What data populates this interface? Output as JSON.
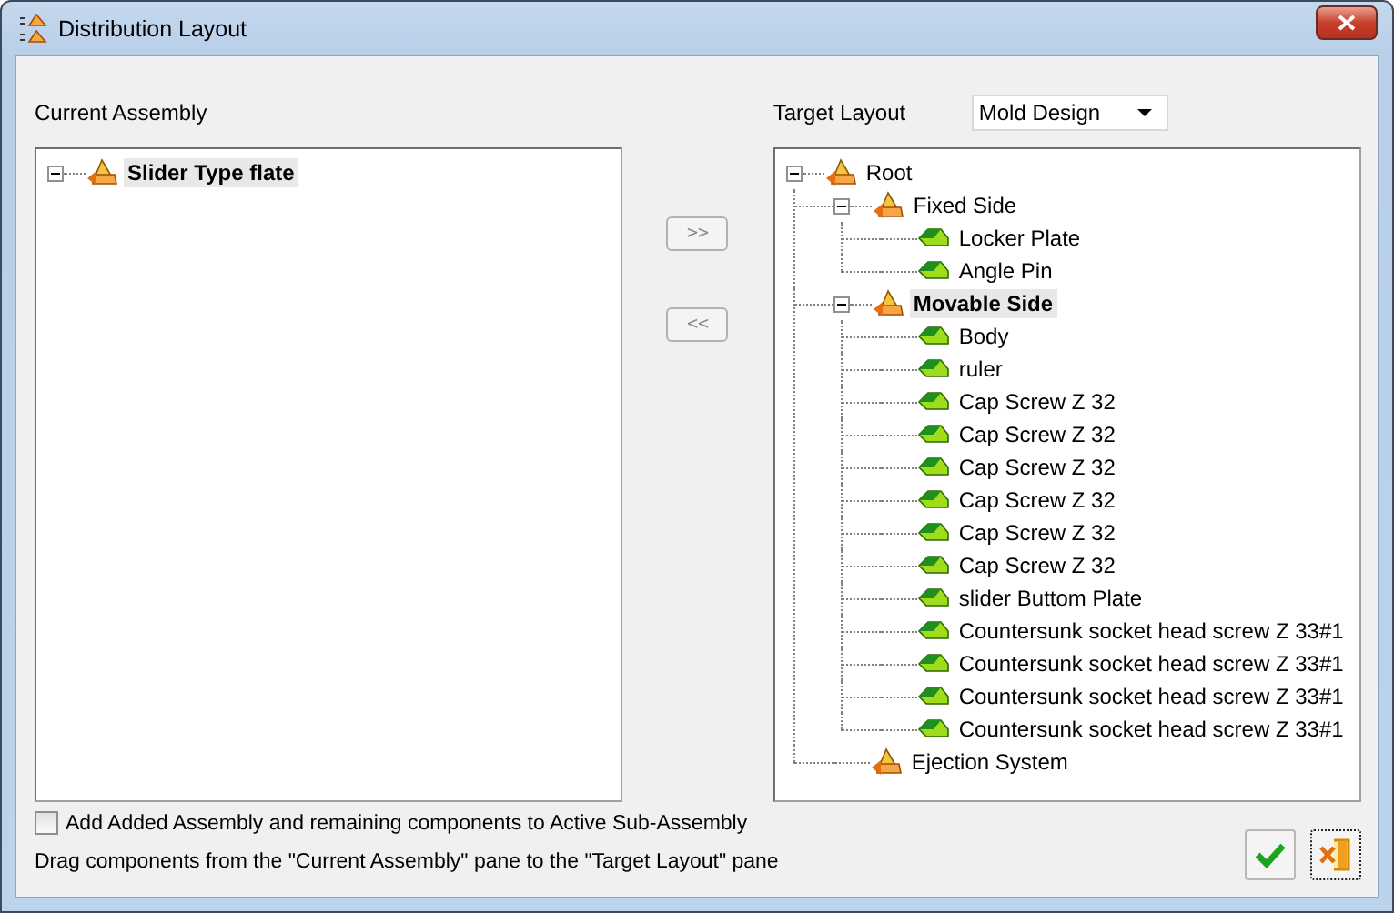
{
  "window": {
    "title": "Distribution Layout"
  },
  "current_assembly": {
    "label": "Current Assembly",
    "tree": [
      {
        "label": "Slider Type flate",
        "kind": "assembly",
        "selected": true,
        "expanded": true
      }
    ]
  },
  "target_layout": {
    "label": "Target Layout",
    "dropdown": {
      "value": "Mold Design"
    },
    "tree": [
      {
        "label": "Root",
        "kind": "assembly",
        "selected": false,
        "expanded": true,
        "children": [
          {
            "label": "Fixed Side",
            "kind": "assembly",
            "selected": false,
            "expanded": true,
            "children": [
              {
                "label": "Locker Plate",
                "kind": "part",
                "selected": false
              },
              {
                "label": "Angle Pin",
                "kind": "part",
                "selected": false
              }
            ]
          },
          {
            "label": "Movable Side",
            "kind": "assembly",
            "selected": true,
            "expanded": true,
            "children": [
              {
                "label": "Body",
                "kind": "part",
                "selected": false
              },
              {
                "label": "ruler",
                "kind": "part",
                "selected": false
              },
              {
                "label": "Cap Screw Z 32",
                "kind": "part",
                "selected": false
              },
              {
                "label": "Cap Screw Z 32",
                "kind": "part",
                "selected": false
              },
              {
                "label": "Cap Screw Z 32",
                "kind": "part",
                "selected": false
              },
              {
                "label": "Cap Screw Z 32",
                "kind": "part",
                "selected": false
              },
              {
                "label": "Cap Screw Z 32",
                "kind": "part",
                "selected": false
              },
              {
                "label": "Cap Screw Z 32",
                "kind": "part",
                "selected": false
              },
              {
                "label": "slider Buttom Plate",
                "kind": "part",
                "selected": false
              },
              {
                "label": "Countersunk socket head screw Z 33#1",
                "kind": "part",
                "selected": false
              },
              {
                "label": "Countersunk socket head screw Z 33#1",
                "kind": "part",
                "selected": false
              },
              {
                "label": "Countersunk socket head screw Z 33#1",
                "kind": "part",
                "selected": false
              },
              {
                "label": "Countersunk socket head screw Z 33#1",
                "kind": "part",
                "selected": false
              }
            ]
          },
          {
            "label": "Ejection System",
            "kind": "assembly",
            "selected": false
          }
        ]
      }
    ]
  },
  "move_buttons": [
    {
      "label": ">>",
      "disabled": true
    },
    {
      "label": "<<",
      "disabled": true
    }
  ],
  "option": {
    "label": "Add Added Assembly and remaining components to Active Sub-Assembly",
    "checked": false
  },
  "hint": "Drag components from the \"Current Assembly\" pane to the \"Target Layout\" pane"
}
